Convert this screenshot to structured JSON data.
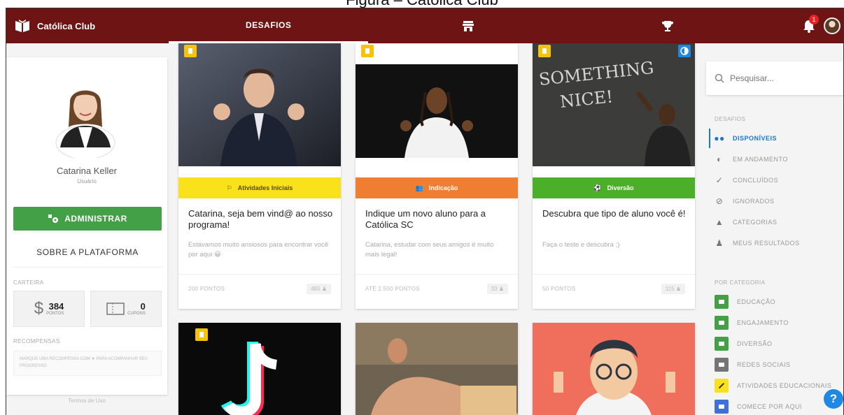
{
  "caption": "Figura – Católica Club",
  "app": {
    "name": "Católica Club"
  },
  "nav": {
    "tabs": [
      {
        "label": "DESAFIOS",
        "icon": ""
      },
      {
        "label": "",
        "icon": "store-icon"
      },
      {
        "label": "",
        "icon": "trophy-icon"
      }
    ],
    "notification_count": "1"
  },
  "profile": {
    "name": "Catarina Keller",
    "role": "Usuário",
    "admin_button": "ADMINISTRAR",
    "about_button": "SOBRE A PLATAFORMA",
    "wallet_label": "CARTEIRA",
    "points_value": "384",
    "points_unit": "PONTOS",
    "coupons_value": "0",
    "coupons_unit": "CUPONS",
    "rewards_label": "RECOMPENSAS",
    "rewards_text": "MARQUE UMA RECOMPENSA COM ★ PARA ACOMPANHAR SEU PROGRESSO",
    "terms": "Termos de Uso"
  },
  "cards": [
    {
      "category": "Atividades Iniciais",
      "category_color": "#f9e21c",
      "category_text_color": "#5a4a00",
      "title": "Catarina, seja bem vind@ ao nosso programa!",
      "description": "Estávamos muito ansiosos para encontrar você por aqui 😀",
      "points": "200 PONTOS",
      "users": "485"
    },
    {
      "category": "Indicação",
      "category_color": "#ef7d32",
      "category_text_color": "#ffffff",
      "title": "Indique um novo aluno para a Católica SC",
      "description": "Catarina, estudar com seus amigos é muito mais legal!",
      "points": "ATÉ 2.500 PONTOS",
      "users": "33"
    },
    {
      "category": "Diversão",
      "category_color": "#4caf2a",
      "category_text_color": "#ffffff",
      "title": "Descubra que tipo de aluno você é!",
      "description": "Faça o teste e descubra ;)",
      "points": "50 PONTOS",
      "users": "115"
    }
  ],
  "sidebar": {
    "search_placeholder": "Pesquisar...",
    "challenges_label": "DESAFIOS",
    "items": [
      {
        "label": "DISPONÍVEIS",
        "icon": "binoculars-icon"
      },
      {
        "label": "EM ANDAMENTO",
        "icon": "half-circle-icon"
      },
      {
        "label": "CONCLUÍDOS",
        "icon": "check-icon"
      },
      {
        "label": "IGNORADOS",
        "icon": "eye-off-icon"
      },
      {
        "label": "CATEGORIAS",
        "icon": "shapes-icon"
      },
      {
        "label": "MEUS RESULTADOS",
        "icon": "person-icon"
      }
    ],
    "by_category_label": "POR CATEGORIA",
    "categories": [
      {
        "label": "EDUCAÇÃO",
        "color": "#43a047"
      },
      {
        "label": "ENGAJAMENTO",
        "color": "#43a047"
      },
      {
        "label": "DIVERSÃO",
        "color": "#43a047"
      },
      {
        "label": "REDES SOCIAIS",
        "color": "#757575"
      },
      {
        "label": "ATIVIDADES EDUCACIONAIS",
        "color": "#f9e21c"
      },
      {
        "label": "COMECE POR AQUI",
        "color": "#3f6fd8"
      }
    ]
  },
  "colors": {
    "topbar": "#6e1414",
    "accent": "#1976d2",
    "admin": "#43a047"
  }
}
